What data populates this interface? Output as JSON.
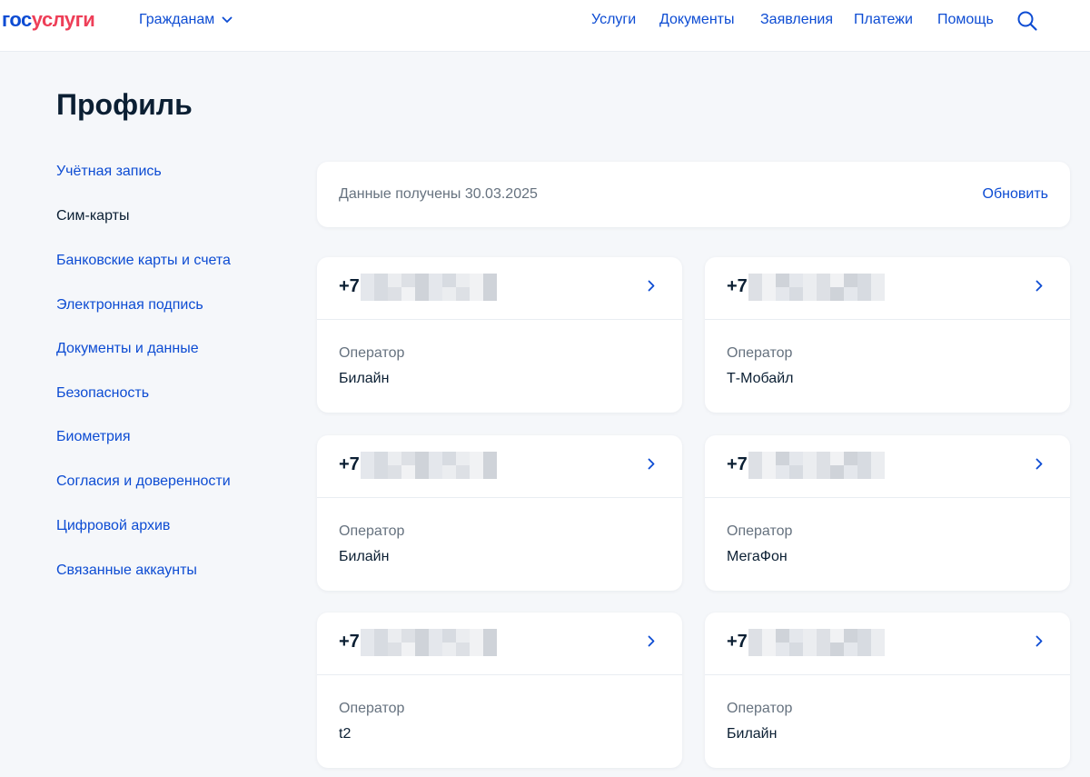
{
  "header": {
    "logo_part1": "гос",
    "logo_part2": "услуги",
    "audience_label": "Гражданам",
    "nav": [
      "Услуги",
      "Документы",
      "Заявления",
      "Платежи",
      "Помощь"
    ],
    "search_icon": "search-icon"
  },
  "page": {
    "title": "Профиль"
  },
  "sidebar": {
    "items": [
      {
        "label": "Учётная запись",
        "active": false
      },
      {
        "label": "Сим-карты",
        "active": true
      },
      {
        "label": "Банковские карты и счета",
        "active": false
      },
      {
        "label": "Электронная подпись",
        "active": false
      },
      {
        "label": "Документы и данные",
        "active": false
      },
      {
        "label": "Безопасность",
        "active": false
      },
      {
        "label": "Биометрия",
        "active": false
      },
      {
        "label": "Согласия и доверенности",
        "active": false
      },
      {
        "label": "Цифровой архив",
        "active": false
      },
      {
        "label": "Связанные аккаунты",
        "active": false
      }
    ]
  },
  "data_bar": {
    "received": "Данные получены 30.03.2025",
    "refresh_label": "Обновить"
  },
  "sim_cards": [
    {
      "phone_prefix": "+7",
      "operator_label": "Оператор",
      "operator": "Билайн"
    },
    {
      "phone_prefix": "+7",
      "operator_label": "Оператор",
      "operator": "Т-Мобайл"
    },
    {
      "phone_prefix": "+7",
      "operator_label": "Оператор",
      "operator": "Билайн"
    },
    {
      "phone_prefix": "+7",
      "operator_label": "Оператор",
      "operator": "МегаФон"
    },
    {
      "phone_prefix": "+7",
      "operator_label": "Оператор",
      "operator": "t2"
    },
    {
      "phone_prefix": "+7",
      "operator_label": "Оператор",
      "operator": "Билайн"
    }
  ],
  "colors": {
    "accent": "#0d4cd3",
    "brand_red": "#ee3f58",
    "text": "#0b1f33",
    "muted": "#66727f",
    "background": "#f5f7fa"
  }
}
